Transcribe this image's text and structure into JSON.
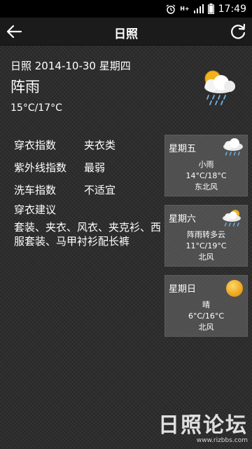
{
  "status_bar": {
    "time": "17:49",
    "net_label": "H+",
    "icons": [
      "alarm-icon",
      "signal-icon",
      "battery-icon"
    ]
  },
  "titlebar": {
    "title": "日照",
    "back_icon": "back-arrow-icon",
    "refresh_icon": "refresh-icon"
  },
  "today": {
    "date_line": "日照 2014-10-30 星期四",
    "condition": "阵雨",
    "temp": "15°C/17°C",
    "icon": "sun-cloud-rain-icon"
  },
  "indices": [
    {
      "label": "穿衣指数",
      "value": "夹衣类"
    },
    {
      "label": "紫外线指数",
      "value": "最弱"
    },
    {
      "label": "洗车指数",
      "value": "不适宜"
    }
  ],
  "advice": {
    "title": "穿衣建议",
    "text": "套装、夹衣、风衣、夹克衫、西服套装、马甲衬衫配长裤"
  },
  "forecast": [
    {
      "day": "星期五",
      "icon": "cloud-rain-icon",
      "condition": "小雨",
      "temp": "14°C/18°C",
      "wind": "东北风"
    },
    {
      "day": "星期六",
      "icon": "sun-cloud-rain-icon",
      "condition": "阵雨转多云",
      "temp": "11°C/19°C",
      "wind": "北风"
    },
    {
      "day": "星期日",
      "icon": "sun-icon",
      "condition": "晴",
      "temp": "6°C/16°C",
      "wind": "北风"
    }
  ],
  "watermark": {
    "logo": "日照论坛",
    "url": "www.rizbbs.com"
  },
  "colors": {
    "background": "#2a2a2a",
    "titlebar": "#1b1b1b",
    "card": "#6e6e6e",
    "sun": "#f2b21c",
    "rain": "#6fb0e0"
  }
}
